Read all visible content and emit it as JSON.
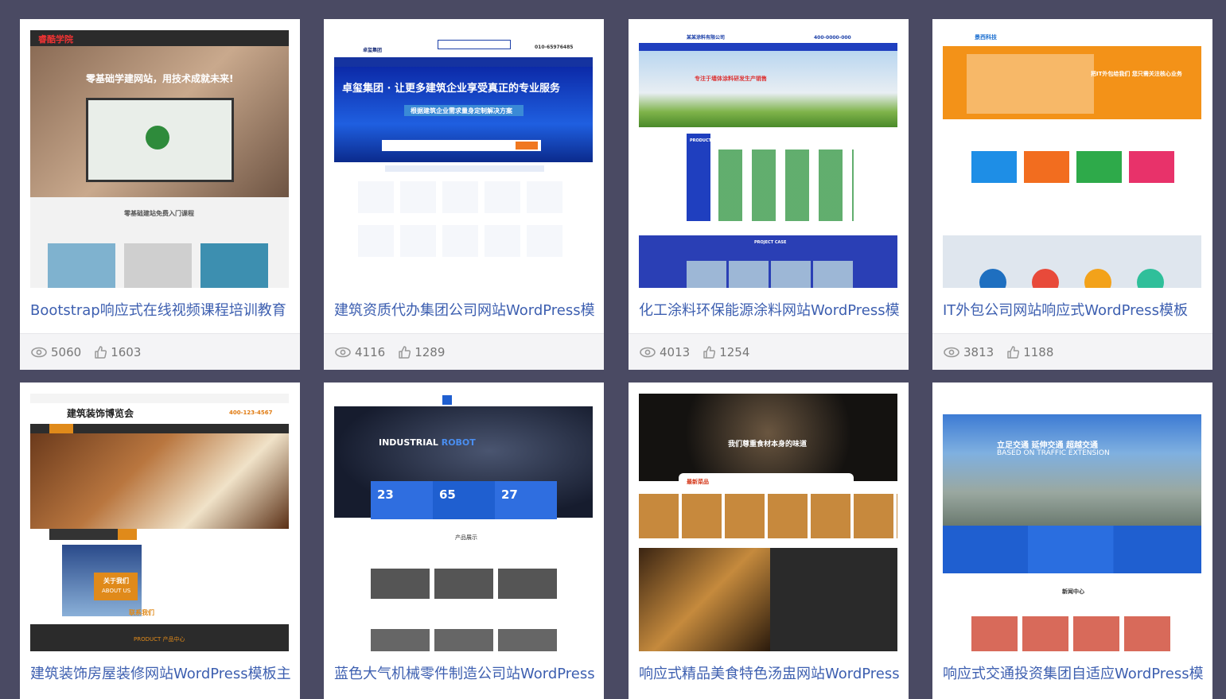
{
  "cards": [
    {
      "title": "Bootstrap响应式在线视频课程培训教育",
      "views": "5060",
      "likes": "1603"
    },
    {
      "title": "建筑资质代办集团公司网站WordPress模",
      "views": "4116",
      "likes": "1289"
    },
    {
      "title": "化工涂料环保能源涂料网站WordPress模",
      "views": "4013",
      "likes": "1254"
    },
    {
      "title": "IT外包公司网站响应式WordPress模板",
      "views": "3813",
      "likes": "1188"
    },
    {
      "title": "建筑装饰房屋装修网站WordPress模板主",
      "views": "",
      "likes": ""
    },
    {
      "title": "蓝色大气机械零件制造公司站WordPress",
      "views": "",
      "likes": ""
    },
    {
      "title": "响应式精品美食特色汤盅网站WordPress",
      "views": "",
      "likes": ""
    },
    {
      "title": "响应式交通投资集团自适应WordPress模",
      "views": "",
      "likes": ""
    }
  ],
  "thumbs": {
    "t1": {
      "brand": "睿酷学院",
      "slogan": "零基础学建网站，用技术成就未来!",
      "sub": "零基础建站免费入门课程"
    },
    "t2": {
      "brand": "卓玺集团",
      "slogan": "卓玺集团 · 让更多建筑企业享受真正的专业服务",
      "sub": "根据建筑企业需求量身定制解决方案",
      "phone": "010-65976485"
    },
    "t3": {
      "brand": "某某涂料有限公司",
      "slogan": "专注于墙体涂料研发生产销售",
      "phone": "400-0000-000",
      "products": "PRODUCTS",
      "case": "PROJECT CASE"
    },
    "t4": {
      "brand": "景西科技",
      "slogan": "把IT外包给我们 您只需关注核心业务"
    },
    "t5": {
      "brand": "建筑装饰博览会",
      "phone": "400-123-4567",
      "about": "关于我们",
      "about_en": "ABOUT US",
      "product": "PRODUCT 产品中心",
      "contact": "联系我们"
    },
    "t6": {
      "slogan1": "INDUSTRIAL",
      "slogan2": "ROBOT",
      "n1": "23",
      "n2": "65",
      "n3": "27",
      "section": "产品展示"
    },
    "t7": {
      "slogan": "我们尊重食材本身的味道",
      "section": "最新菜品"
    },
    "t8": {
      "slogan": "立足交通 延伸交通 超越交通",
      "slogan_en": "BASED ON TRAFFIC EXTENSION",
      "section": "新闻中心"
    }
  },
  "colors": {
    "accent": "#3d5fb0",
    "page_bg": "#4a4a63"
  }
}
